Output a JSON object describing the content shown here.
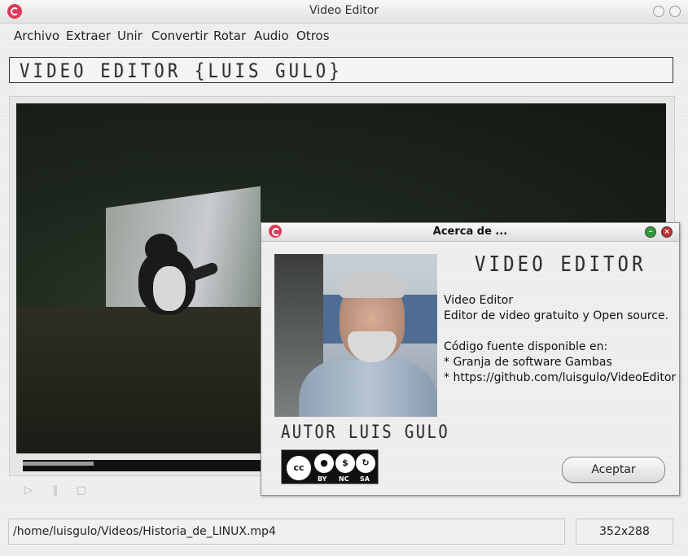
{
  "window": {
    "title": "Video Editor"
  },
  "menu": {
    "items": [
      "Archivo",
      "Extraer",
      "Unir",
      "Convertir",
      "Rotar",
      "Audio",
      "Otros"
    ]
  },
  "banner": {
    "text": "VIDEO EDITOR {LUIS GULO}"
  },
  "player": {
    "progress_percent": 11,
    "controls": [
      "play-icon",
      "pause-icon",
      "stop-icon"
    ]
  },
  "status": {
    "file_path": "/home/luisgulo/Videos/Historia_de_LINUX.mp4",
    "resolution": "352x288"
  },
  "about_dialog": {
    "title": "Acerca de ...",
    "heading": "VIDEO EDITOR",
    "author": "AUTOR LUIS GULO",
    "text": "Video Editor\nEditor de video gratuito y Open source.\n\nCódigo fuente disponible en:\n* Granja de software Gambas\n* https://github.com/luisgulo/VideoEditor",
    "license": {
      "cc": "cc",
      "badges": [
        "BY",
        "NC",
        "SA"
      ]
    },
    "accept_label": "Aceptar"
  },
  "colors": {
    "accent": "#e03a5a",
    "video_bg": "#1d261d",
    "dialog_min": "#2e9b3a",
    "dialog_close": "#c2302f"
  }
}
